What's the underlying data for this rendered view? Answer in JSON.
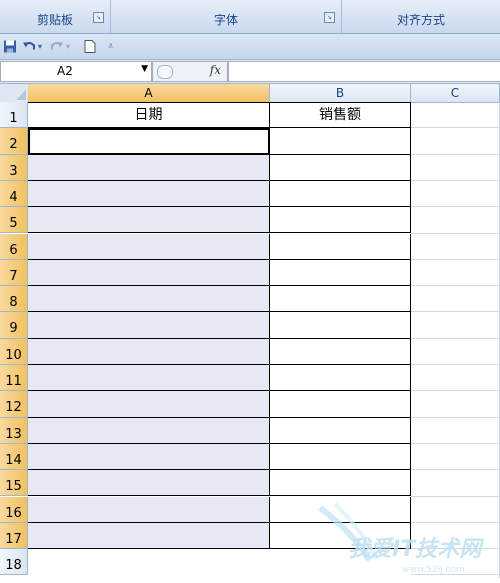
{
  "ribbon": {
    "groups": [
      {
        "label": "剪贴板",
        "launcher": "dialog-launcher-icon"
      },
      {
        "label": "字体",
        "launcher": "dialog-launcher-icon"
      },
      {
        "label": "对齐方式",
        "launcher": null
      }
    ]
  },
  "quick_access": {
    "icons": [
      "save-icon",
      "undo-icon",
      "redo-icon",
      "new-document-icon",
      "customize-dropdown-icon"
    ]
  },
  "formula_bar": {
    "name_box_value": "A2",
    "fx_label": "fx",
    "formula_value": ""
  },
  "sheet": {
    "columns": [
      "A",
      "B",
      "C"
    ],
    "selected_column": "A",
    "rows": [
      "1",
      "2",
      "3",
      "4",
      "5",
      "6",
      "7",
      "8",
      "9",
      "10",
      "11",
      "12",
      "13",
      "14",
      "15",
      "16",
      "17",
      "18"
    ],
    "selected_rows": [
      "2",
      "3",
      "4",
      "5",
      "6",
      "7",
      "8",
      "9",
      "10",
      "11",
      "12",
      "13",
      "14",
      "15",
      "16",
      "17"
    ],
    "header_cells": {
      "A1": "日期",
      "B1": "销售额"
    },
    "active_cell": "A2"
  },
  "watermark": {
    "text": "我爱IT技术网",
    "sub": "www.52ij.com"
  },
  "colors": {
    "selection_fill": "#e6e8f4",
    "header_selected": "#f1c15f",
    "ribbon_text": "#15428b"
  }
}
